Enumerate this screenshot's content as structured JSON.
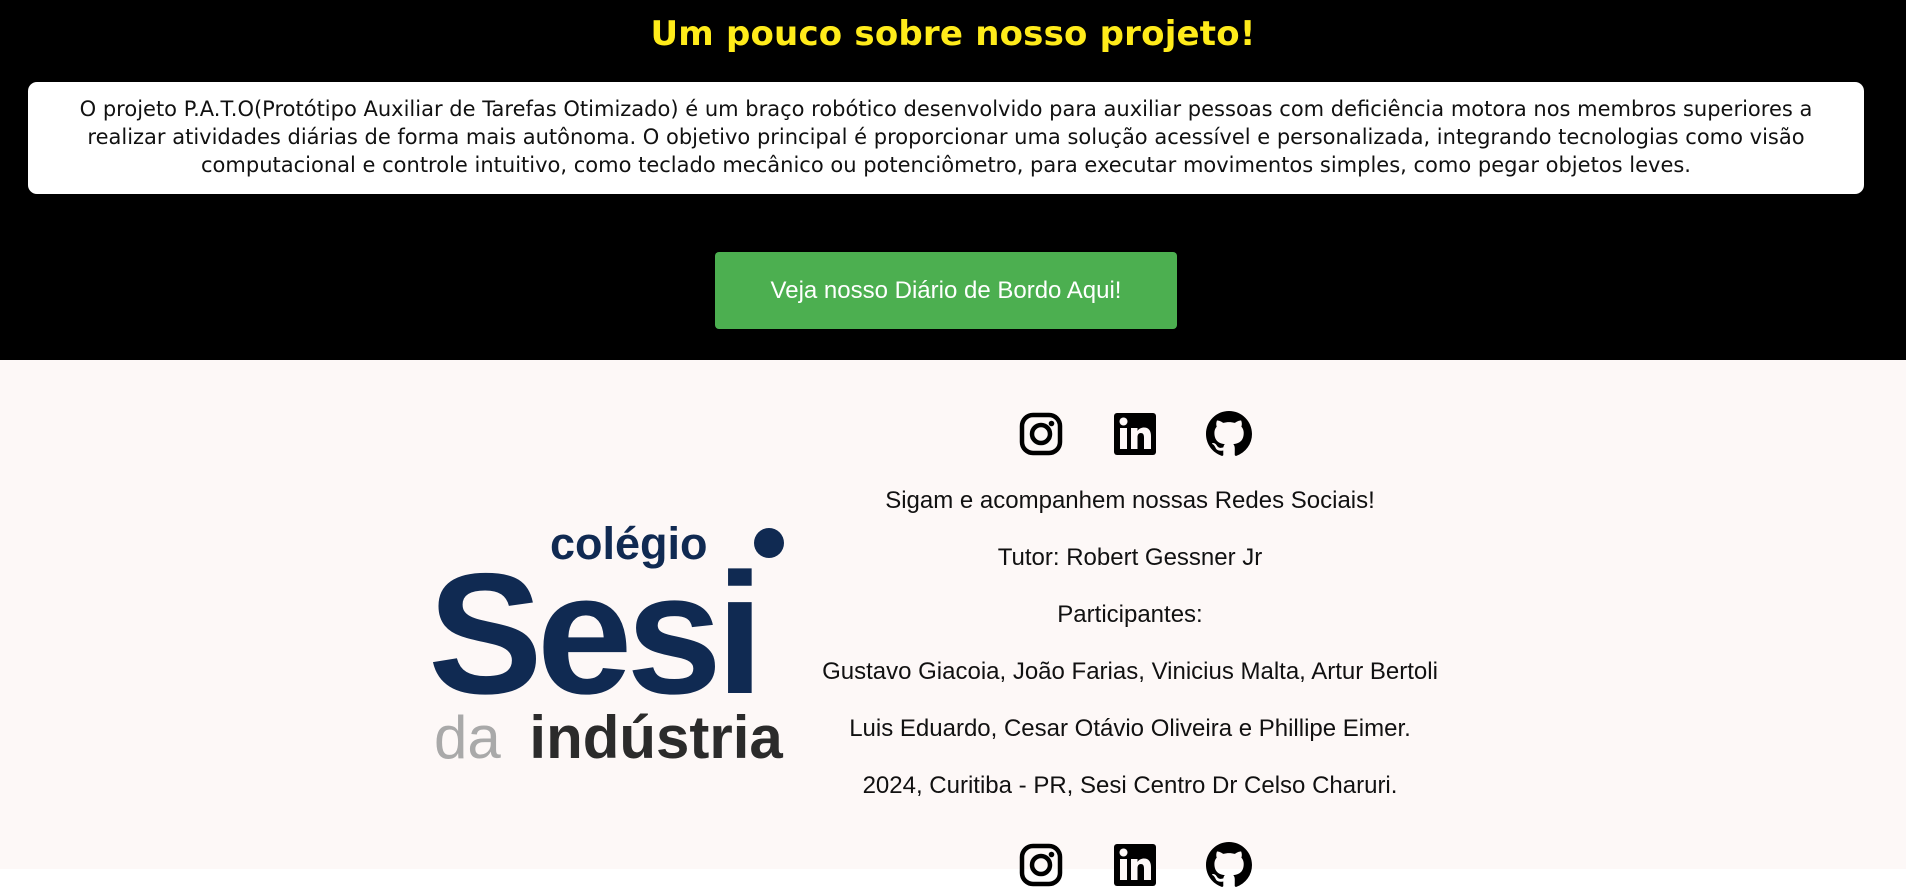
{
  "about": {
    "title": "Um pouco sobre nosso projeto!",
    "description": "O projeto P.A.T.O(Protótipo Auxiliar de Tarefas Otimizado) é um braço robótico desenvolvido para auxiliar pessoas com deficiência motora nos membros superiores a realizar atividades diárias de forma mais autônoma. O objetivo principal é proporcionar uma solução acessível e personalizada, integrando tecnologias como visão computacional e controle intuitivo, como teclado mecânico ou potenciômetro, para executar movimentos simples, como pegar objetos leves.",
    "button_label": "Veja nosso Diário de Bordo Aqui!"
  },
  "footer": {
    "logo": {
      "line1": "colégio",
      "line2": "Sesi",
      "line3_light": "da",
      "line3_bold": "indústria"
    },
    "social_icons": [
      "instagram-icon",
      "linkedin-icon",
      "github-icon"
    ],
    "follow_text": "Sigam e acompanhem nossas Redes Sociais!",
    "tutor": "Tutor: Robert Gessner Jr",
    "participants_label": "Participantes:",
    "participants_line1": "Gustavo Giacoia, João Farias, Vinicius Malta, Artur Bertoli",
    "participants_line2": "Luis Eduardo, Cesar Otávio Oliveira e Phillipe Eimer.",
    "location": "2024, Curitiba - PR, Sesi Centro Dr Celso Charuri."
  },
  "colors": {
    "title": "#ffeb1a",
    "button": "#4caf50",
    "logo_navy": "#102a52",
    "footer_bg": "#fdf8f7"
  }
}
